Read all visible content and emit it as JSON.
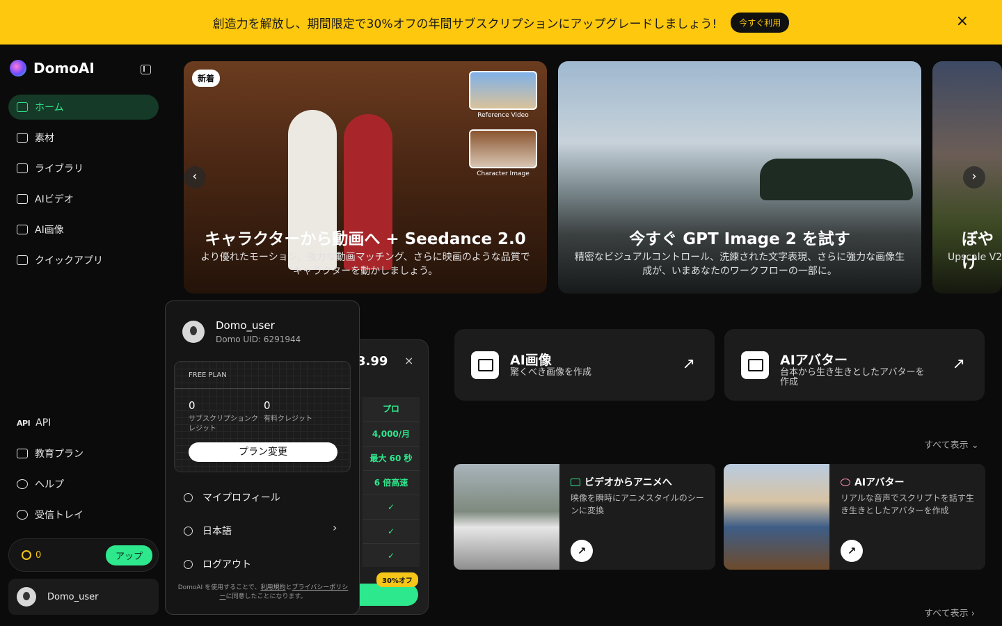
{
  "banner": {
    "text": "創造力を解放し、期間限定で30%オフの年間サブスクリプションにアップグレードしましょう!",
    "button": "今すぐ利用",
    "close": "×"
  },
  "app": {
    "name": "DomoAI"
  },
  "sidebar": {
    "items": [
      {
        "label": "ホーム",
        "icon": "home-icon",
        "active": true
      },
      {
        "label": "素材",
        "icon": "assets-icon"
      },
      {
        "label": "ライブラリ",
        "icon": "library-icon"
      },
      {
        "label": "AIビデオ",
        "icon": "video-icon"
      },
      {
        "label": "AI画像",
        "icon": "image-icon"
      },
      {
        "label": "クイックアプリ",
        "icon": "apps-icon"
      }
    ],
    "bottom": [
      {
        "label": "API",
        "tag": "API"
      },
      {
        "label": "教育プラン",
        "icon": "education-icon"
      },
      {
        "label": "ヘルプ",
        "icon": "help-icon"
      },
      {
        "label": "受信トレイ",
        "icon": "bell-icon"
      }
    ],
    "credits": "0",
    "upgrade": "アップ",
    "username": "Domo_user"
  },
  "carousel": {
    "cards": [
      {
        "badge": "新着",
        "title": "キャラクターから動画へ + Seedance 2.0",
        "subtitle": "より優れたモーション、強力な動画マッチング、さらに映画のような品質でキャラクターを動かしましょう。",
        "thumb1": "Reference Video",
        "thumb2": "Character Image"
      },
      {
        "title": "今すぐ GPT Image 2 を試す",
        "subtitle": "精密なビジュアルコントロール、洗練された文字表現、さらに強力な画像生成が、いまあなたのワークフローの一部に。"
      },
      {
        "title": "ぼやけ",
        "subtitle": "Upscale V2"
      }
    ],
    "prev": "‹",
    "next": "›"
  },
  "features": [
    {
      "title": "AI画像",
      "subtitle": "驚くべき画像を作成"
    },
    {
      "title": "AIアバター",
      "subtitle": "台本から生き生きとしたアバターを作成"
    }
  ],
  "see_all": "すべて表示",
  "templates": [
    {
      "title": "ビデオからアニメへ",
      "subtitle": "映像を瞬時にアニメスタイルのシーンに変換"
    },
    {
      "title": "AIアバター",
      "subtitle": "リアルな音声でスクリプトを話す生き生きとしたアバターを作成"
    }
  ],
  "plan_panel": {
    "price": "3.99",
    "close": "×",
    "header": "プロ",
    "rows": [
      "4,000/月",
      "最大 60 秒",
      "6 倍高速",
      "✓",
      "✓",
      "✓"
    ],
    "discount": "30%オフ"
  },
  "user_menu": {
    "name": "Domo_user",
    "uid": "Domo UID: 6291944",
    "plan": "FREE PLAN",
    "sub_credits": "0",
    "sub_credits_label": "サブスクリプションクレジット",
    "paid_credits": "0",
    "paid_credits_label": "有料クレジット",
    "change_plan": "プラン変更",
    "profile": "マイプロフィール",
    "language": "日本語",
    "logout": "ログアウト",
    "footer_a": "DomoAI を使用することで、",
    "footer_terms": "利用規約",
    "footer_and": "と",
    "footer_privacy": "プライバシーポリシー",
    "footer_b": "に同意したことになります。"
  }
}
